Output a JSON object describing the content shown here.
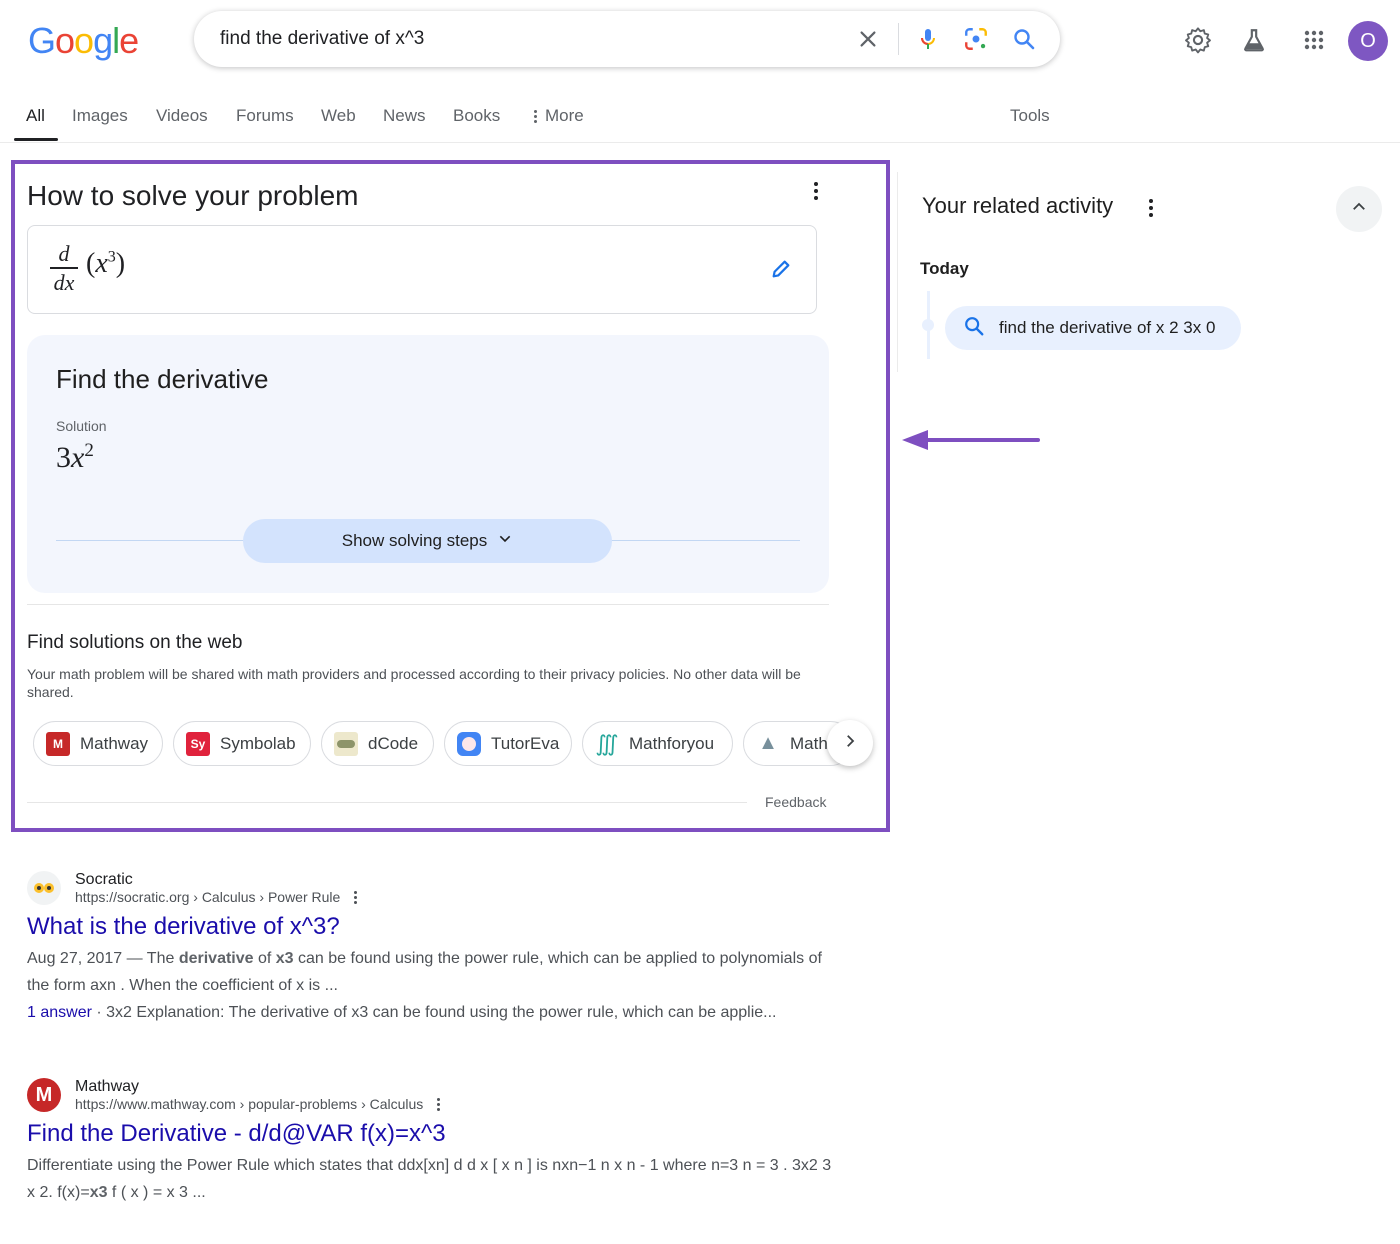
{
  "header": {
    "logo_letters": [
      "G",
      "o",
      "o",
      "g",
      "l",
      "e"
    ],
    "search_query": "find the derivative of x^3",
    "icons": {
      "clear": "close-icon",
      "voice": "microphone-icon",
      "lens": "camera-lens-icon",
      "search": "search-icon",
      "settings": "gear-icon",
      "labs": "flask-icon",
      "apps": "apps-grid-icon"
    },
    "avatar_initial": "O"
  },
  "tabs": {
    "items": [
      "All",
      "Images",
      "Videos",
      "Forums",
      "Web",
      "News",
      "Books"
    ],
    "more_label": "More",
    "tools_label": "Tools",
    "active": "All"
  },
  "solver": {
    "title": "How to solve your problem",
    "expression": {
      "numerator": "d",
      "denominator": "dx",
      "variable": "x",
      "exponent": "3"
    },
    "result_card": {
      "title": "Find the derivative",
      "solution_label": "Solution",
      "solution_coef": "3",
      "solution_var": "x",
      "solution_exp": "2",
      "steps_button": "Show solving steps"
    },
    "web": {
      "title": "Find solutions on the web",
      "description": "Your math problem will be shared with math providers and processed according to their privacy policies. No other data will be shared.",
      "providers": [
        {
          "name": "Mathway",
          "icon": "M",
          "color": "#c62828"
        },
        {
          "name": "Symbolab",
          "icon": "Sy",
          "color": "#e0223c"
        },
        {
          "name": "dCode",
          "icon": "",
          "color": "#e9e4c6"
        },
        {
          "name": "TutorEva",
          "icon": "",
          "color": "#4285f4"
        },
        {
          "name": "Mathforyou",
          "icon": "∭",
          "color": "#26a69a"
        },
        {
          "name": "MathD",
          "icon": "▲",
          "color": "#78909c"
        }
      ]
    },
    "feedback": "Feedback"
  },
  "related_activity": {
    "title": "Your related activity",
    "section": "Today",
    "items": [
      "find the derivative of x 2 3x 0"
    ]
  },
  "results": [
    {
      "site": "Socratic",
      "url": "https://socratic.org › Calculus › Power Rule",
      "title": "What is the derivative of x^3?",
      "date": "Aug 27, 2017",
      "snippet_pre": " — The ",
      "snippet_b1": "derivative",
      "snippet_mid": " of ",
      "snippet_b2": "x3",
      "snippet_post": " can be found using the power rule, which can be applied to polynomials of the form axn . When the coefficient of x is ...",
      "answers_link": "1 answer",
      "answers_text": " · 3x2 Explanation: The derivative of x3 can be found using the power rule, which can be applie..."
    },
    {
      "site": "Mathway",
      "url": "https://www.mathway.com › popular-problems › Calculus",
      "title": "Find the Derivative - d/d@VAR f(x)=x^3",
      "snippet_pre": "Differentiate using the Power Rule which states that ddx[xn] d d x [ x n ] is nxn−1 n x n - 1 where n=3 n = 3 . 3x2 3 x 2. f(x)=",
      "snippet_b": "x3",
      "snippet_post": " f ( x ) = x 3 ..."
    }
  ],
  "annotation": {
    "highlight_color": "#7e4fc0"
  }
}
